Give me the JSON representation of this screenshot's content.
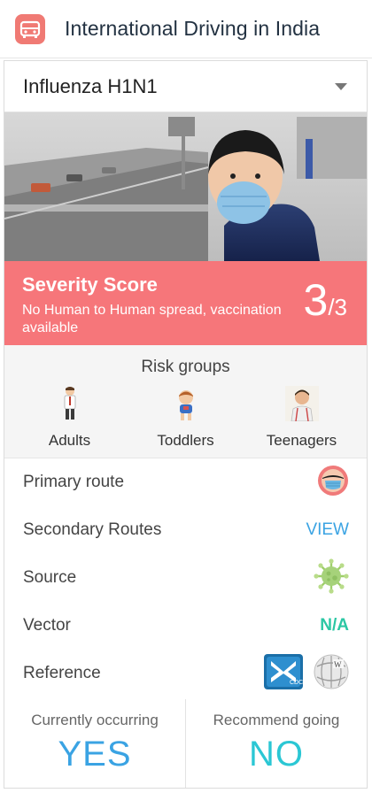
{
  "app": {
    "title": "International Driving in India",
    "icon": "car-icon"
  },
  "selector": {
    "value": "Influenza H1N1"
  },
  "photo": {
    "description": "child-in-mask"
  },
  "severity": {
    "title": "Severity Score",
    "description": "No Human to Human spread, vaccination available",
    "score": "3",
    "max": "/3"
  },
  "risk": {
    "title": "Risk groups",
    "items": [
      {
        "label": "Adults",
        "icon": "adult-icon"
      },
      {
        "label": "Toddlers",
        "icon": "toddler-icon"
      },
      {
        "label": "Teenagers",
        "icon": "teenager-icon"
      }
    ]
  },
  "details": {
    "primary_route": {
      "label": "Primary route",
      "icon": "mask-face-icon"
    },
    "secondary_routes": {
      "label": "Secondary Routes",
      "action": "VIEW"
    },
    "source": {
      "label": "Source",
      "icon": "virus-icon"
    },
    "vector": {
      "label": "Vector",
      "value": "N/A"
    },
    "reference": {
      "label": "Reference",
      "icons": [
        "cdc-icon",
        "wikipedia-icon"
      ]
    }
  },
  "status": {
    "occurring": {
      "label": "Currently occurring",
      "value": "YES"
    },
    "recommend": {
      "label": "Recommend going",
      "value": "NO"
    }
  },
  "colors": {
    "severity": "#f6767a",
    "accent_blue": "#3aa3e3",
    "accent_teal": "#2bc7a4",
    "title": "#233242"
  }
}
